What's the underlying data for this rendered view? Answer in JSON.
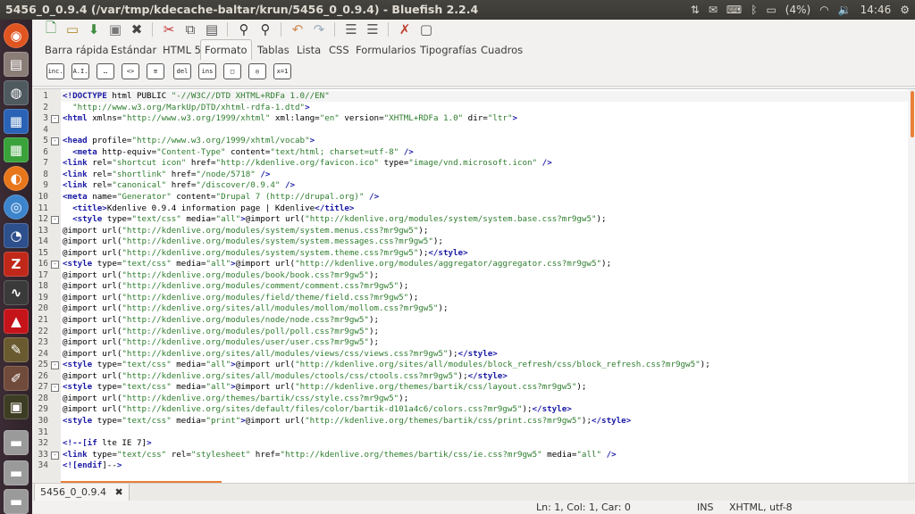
{
  "window_title": "5456_0_0.9.4 (/var/tmp/kdecache-baltar/krun/5456_0_0.9.4) - Bluefish 2.2.4",
  "tray": {
    "battery": "(4%)",
    "clock": "14:46"
  },
  "tabs": [
    "Barra rápida",
    "Estándar",
    "HTML 5",
    "Formato",
    "Tablas",
    "Lista",
    "CSS",
    "Formularios",
    "Tipografías",
    "Cuadros"
  ],
  "active_tab": "Formato",
  "format_buttons": [
    "inc.",
    "A.I.",
    "…",
    "<>",
    "≡",
    "del",
    "ins",
    "□",
    "◎",
    "x=1"
  ],
  "code_lines": [
    "<!DOCTYPE html PUBLIC \"-//W3C//DTD XHTML+RDFa 1.0//EN\"",
    "  \"http://www.w3.org/MarkUp/DTD/xhtml-rdfa-1.dtd\">",
    "<html xmlns=\"http://www.w3.org/1999/xhtml\" xml:lang=\"en\" version=\"XHTML+RDFa 1.0\" dir=\"ltr\">",
    "",
    "<head profile=\"http://www.w3.org/1999/xhtml/vocab\">",
    "  <meta http-equiv=\"Content-Type\" content=\"text/html; charset=utf-8\" />",
    "<link rel=\"shortcut icon\" href=\"http://kdenlive.org/favicon.ico\" type=\"image/vnd.microsoft.icon\" />",
    "<link rel=\"shortlink\" href=\"/node/5718\" />",
    "<link rel=\"canonical\" href=\"/discover/0.9.4\" />",
    "<meta name=\"Generator\" content=\"Drupal 7 (http://drupal.org)\" />",
    "  <title>Kdenlive 0.9.4 information page | Kdenlive</title>",
    "  <style type=\"text/css\" media=\"all\">@import url(\"http://kdenlive.org/modules/system/system.base.css?mr9gw5\");",
    "@import url(\"http://kdenlive.org/modules/system/system.menus.css?mr9gw5\");",
    "@import url(\"http://kdenlive.org/modules/system/system.messages.css?mr9gw5\");",
    "@import url(\"http://kdenlive.org/modules/system/system.theme.css?mr9gw5\");</style>",
    "<style type=\"text/css\" media=\"all\">@import url(\"http://kdenlive.org/modules/aggregator/aggregator.css?mr9gw5\");",
    "@import url(\"http://kdenlive.org/modules/book/book.css?mr9gw5\");",
    "@import url(\"http://kdenlive.org/modules/comment/comment.css?mr9gw5\");",
    "@import url(\"http://kdenlive.org/modules/field/theme/field.css?mr9gw5\");",
    "@import url(\"http://kdenlive.org/sites/all/modules/mollom/mollom.css?mr9gw5\");",
    "@import url(\"http://kdenlive.org/modules/node/node.css?mr9gw5\");",
    "@import url(\"http://kdenlive.org/modules/poll/poll.css?mr9gw5\");",
    "@import url(\"http://kdenlive.org/modules/user/user.css?mr9gw5\");",
    "@import url(\"http://kdenlive.org/sites/all/modules/views/css/views.css?mr9gw5\");</style>",
    "<style type=\"text/css\" media=\"all\">@import url(\"http://kdenlive.org/sites/all/modules/block_refresh/css/block_refresh.css?mr9gw5\");",
    "@import url(\"http://kdenlive.org/sites/all/modules/ctools/css/ctools.css?mr9gw5\");</style>",
    "<style type=\"text/css\" media=\"all\">@import url(\"http://kdenlive.org/themes/bartik/css/layout.css?mr9gw5\");",
    "@import url(\"http://kdenlive.org/themes/bartik/css/style.css?mr9gw5\");",
    "@import url(\"http://kdenlive.org/sites/default/files/color/bartik-d101a4c6/colors.css?mr9gw5\");</style>",
    "<style type=\"text/css\" media=\"print\">@import url(\"http://kdenlive.org/themes/bartik/css/print.css?mr9gw5\");</style>",
    "",
    "<!--[if lte IE 7]>",
    "<link type=\"text/css\" rel=\"stylesheet\" href=\"http://kdenlive.org/themes/bartik/css/ie.css?mr9gw5\" media=\"all\" />",
    "<![endif]-->"
  ],
  "document_tab": "5456_0_0.9.4",
  "status": {
    "position": "Ln: 1, Col: 1, Car: 0",
    "mode": "INS",
    "encoding": "XHTML, utf-8"
  },
  "colors": {
    "accent": "#e9803a",
    "tag": "#1a1aa6",
    "string": "#2e7d2e"
  }
}
